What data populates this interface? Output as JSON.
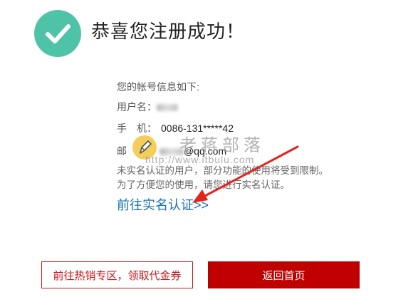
{
  "header": {
    "title": "恭喜您注册成功！",
    "icon": "checkmark-circle-icon",
    "icon_color": "#4fc3a8"
  },
  "account": {
    "heading": "您的帐号信息如下:",
    "username_label": "用户名：",
    "phone_label": "手　机：",
    "phone_value": "0086-131*****42",
    "email_label": "邮",
    "email_value": "@qq.com"
  },
  "notice": {
    "line1": "未实名认证的用户，部分功能的使用将受到限制。",
    "line2": "为了方便您的使用，请您进行实名认证。"
  },
  "verify_link": "前往实名认证>>",
  "watermark": {
    "text": "老蒋部落",
    "url": "http://www.itbulu.com"
  },
  "buttons": {
    "coupon": "前往热销专区，领取代金券",
    "home": "返回首页"
  },
  "colors": {
    "accent_red": "#c00000",
    "link_blue": "#1a73b4",
    "arrow_red": "#e5231f"
  }
}
